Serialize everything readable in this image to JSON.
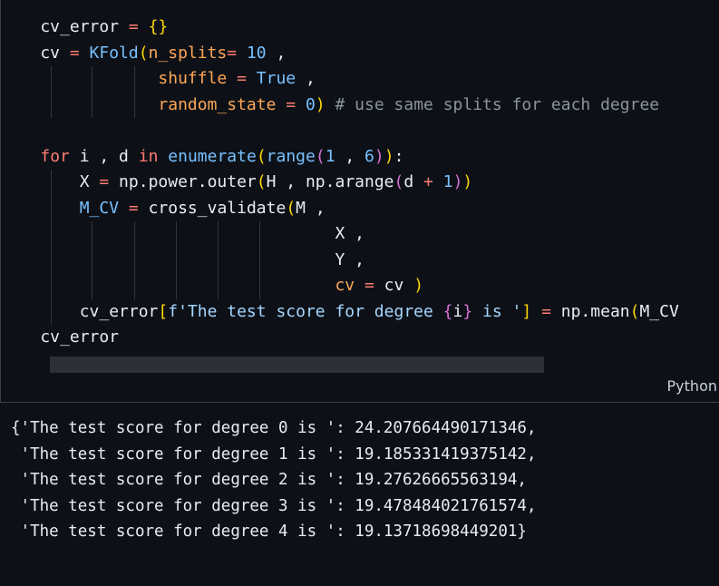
{
  "cell": {
    "language": "Python",
    "lines": [
      [
        [
          "var",
          "    cv_error "
        ],
        [
          "kw",
          "="
        ],
        [
          "var",
          " "
        ],
        [
          "b1",
          "{}"
        ]
      ],
      [
        [
          "var",
          "    cv "
        ],
        [
          "kw",
          "="
        ],
        [
          "var",
          " "
        ],
        [
          "call",
          "KFold"
        ],
        [
          "b1",
          "("
        ],
        [
          "pm",
          "n_splits"
        ],
        [
          "kw",
          "="
        ],
        [
          "var",
          " "
        ],
        [
          "num",
          "10"
        ],
        [
          "var",
          " ,"
        ]
      ],
      [
        [
          "var",
          "                "
        ],
        [
          "pm",
          "shuffle"
        ],
        [
          "var",
          " "
        ],
        [
          "kw",
          "="
        ],
        [
          "var",
          " "
        ],
        [
          "num",
          "True"
        ],
        [
          "var",
          " ,"
        ]
      ],
      [
        [
          "var",
          "                "
        ],
        [
          "pm",
          "random_state"
        ],
        [
          "var",
          " "
        ],
        [
          "kw",
          "="
        ],
        [
          "var",
          " "
        ],
        [
          "num",
          "0"
        ],
        [
          "b1",
          ")"
        ],
        [
          "var",
          " "
        ],
        [
          "cm",
          "# use same splits for each degree"
        ]
      ],
      [
        [
          "var",
          ""
        ]
      ],
      [
        [
          "var",
          "    "
        ],
        [
          "kw",
          "for"
        ],
        [
          "var",
          " i , d "
        ],
        [
          "kw",
          "in"
        ],
        [
          "var",
          " "
        ],
        [
          "call",
          "enumerate"
        ],
        [
          "b1",
          "("
        ],
        [
          "call",
          "range"
        ],
        [
          "b2",
          "("
        ],
        [
          "num",
          "1"
        ],
        [
          "var",
          " , "
        ],
        [
          "num",
          "6"
        ],
        [
          "b2",
          ")"
        ],
        [
          "b1",
          ")"
        ],
        [
          "var",
          ":"
        ]
      ],
      [
        [
          "var",
          "        X "
        ],
        [
          "kw",
          "="
        ],
        [
          "var",
          " np.power.outer"
        ],
        [
          "b1",
          "("
        ],
        [
          "var",
          "H , np.arange"
        ],
        [
          "b2",
          "("
        ],
        [
          "var",
          "d "
        ],
        [
          "kw",
          "+"
        ],
        [
          "var",
          " "
        ],
        [
          "num",
          "1"
        ],
        [
          "b2",
          ")"
        ],
        [
          "b1",
          ")"
        ]
      ],
      [
        [
          "var",
          "        "
        ],
        [
          "call",
          "M_CV"
        ],
        [
          "var",
          " "
        ],
        [
          "kw",
          "="
        ],
        [
          "var",
          " cross_validate"
        ],
        [
          "b1",
          "("
        ],
        [
          "var",
          "M ,"
        ]
      ],
      [
        [
          "var",
          "                                  X ,"
        ]
      ],
      [
        [
          "var",
          "                                  Y ,"
        ]
      ],
      [
        [
          "var",
          "                                  "
        ],
        [
          "pm",
          "cv"
        ],
        [
          "var",
          " "
        ],
        [
          "kw",
          "="
        ],
        [
          "var",
          " cv "
        ],
        [
          "b1",
          ")"
        ]
      ],
      [
        [
          "var",
          "        cv_error"
        ],
        [
          "b1",
          "["
        ],
        [
          "str",
          "f'The test score for degree "
        ],
        [
          "b2",
          "{"
        ],
        [
          "var",
          "i"
        ],
        [
          "b2",
          "}"
        ],
        [
          "str",
          " is '"
        ],
        [
          "b1",
          "]"
        ],
        [
          "var",
          " "
        ],
        [
          "kw",
          "="
        ],
        [
          "var",
          " np.mean"
        ],
        [
          "b1",
          "("
        ],
        [
          "var",
          "M_CV"
        ]
      ],
      [
        [
          "var",
          "    cv_error"
        ]
      ]
    ]
  },
  "output": {
    "lines": [
      "{'The test score for degree 0 is ': 24.207664490171346,",
      " 'The test score for degree 1 is ': 19.185331419375142,",
      " 'The test score for degree 2 is ': 19.27626665563194,",
      " 'The test score for degree 3 is ': 19.478484021761574,",
      " 'The test score for degree 4 is ': 19.13718698449201}"
    ]
  }
}
